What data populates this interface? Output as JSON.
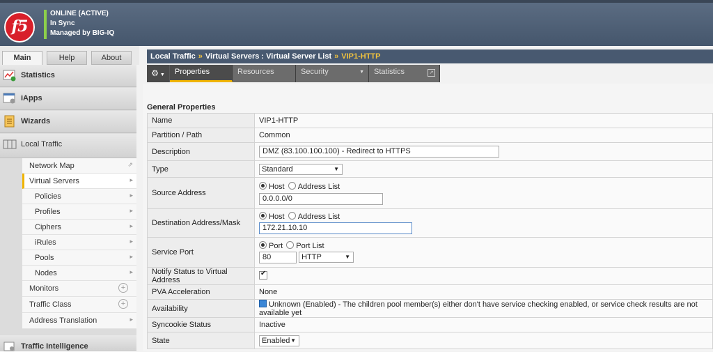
{
  "banner": {
    "logo_text": "f5",
    "status_lines": [
      "ONLINE (ACTIVE)",
      "In Sync",
      "Managed by BIG-IQ"
    ],
    "status_color": "#8dd04b"
  },
  "left_tabs": [
    "Main",
    "Help",
    "About"
  ],
  "sidebar": {
    "sections": [
      {
        "label": "Statistics",
        "icon": "statistics-icon"
      },
      {
        "label": "iApps",
        "icon": "iapps-icon"
      },
      {
        "label": "Wizards",
        "icon": "wizards-icon"
      },
      {
        "label": "Local Traffic",
        "icon": "local-traffic-icon"
      }
    ],
    "local_traffic_items": [
      "Network Map",
      "Virtual Servers",
      "Policies",
      "Profiles",
      "Ciphers",
      "iRules",
      "Pools",
      "Nodes",
      "Monitors",
      "Traffic Class",
      "Address Translation"
    ],
    "bottom_section": {
      "label": "Traffic Intelligence",
      "icon": "traffic-intelligence-icon"
    }
  },
  "breadcrumb": {
    "part1": "Local Traffic",
    "sep": "»",
    "part2": "Virtual Servers : Virtual Server List",
    "current": "VIP1-HTTP"
  },
  "tabs": [
    "Properties",
    "Resources",
    "Security",
    "Statistics"
  ],
  "section_title": "General Properties",
  "properties": {
    "name": {
      "label": "Name",
      "value": "VIP1-HTTP"
    },
    "partition": {
      "label": "Partition / Path",
      "value": "Common"
    },
    "description": {
      "label": "Description",
      "value": "DMZ (83.100.100.100) - Redirect to HTTPS"
    },
    "type": {
      "label": "Type",
      "value": "Standard"
    },
    "source": {
      "label": "Source Address",
      "opt1": "Host",
      "opt2": "Address List",
      "value": "0.0.0.0/0"
    },
    "destination": {
      "label": "Destination Address/Mask",
      "opt1": "Host",
      "opt2": "Address List",
      "value": "172.21.10.10"
    },
    "service_port": {
      "label": "Service Port",
      "opt1": "Port",
      "opt2": "Port List",
      "value": "80",
      "protocol": "HTTP"
    },
    "notify": {
      "label": "Notify Status to Virtual Address"
    },
    "pva": {
      "label": "PVA Acceleration",
      "value": "None"
    },
    "availability": {
      "label": "Availability",
      "value": "Unknown (Enabled) - The children pool member(s) either don't have service checking enabled, or service check results are not available yet"
    },
    "syncookie": {
      "label": "Syncookie Status",
      "value": "Inactive"
    },
    "state": {
      "label": "State",
      "value": "Enabled"
    }
  }
}
